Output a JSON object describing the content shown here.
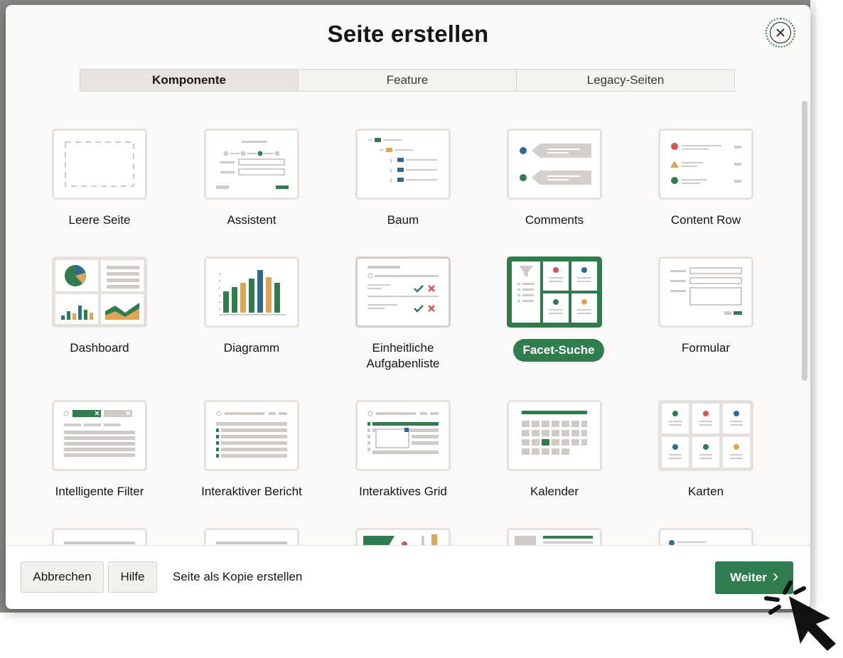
{
  "dialog": {
    "title": "Seite erstellen",
    "close_icon": "close-circle-icon"
  },
  "tabs": [
    {
      "label": "Komponente",
      "active": true
    },
    {
      "label": "Feature",
      "active": false
    },
    {
      "label": "Legacy-Seiten",
      "active": false
    }
  ],
  "tiles": [
    {
      "label": "Leere Seite",
      "icon": "blank-page-icon"
    },
    {
      "label": "Assistent",
      "icon": "wizard-icon"
    },
    {
      "label": "Baum",
      "icon": "tree-icon"
    },
    {
      "label": "Comments",
      "icon": "comments-icon"
    },
    {
      "label": "Content Row",
      "icon": "content-row-icon"
    },
    {
      "label": "Dashboard",
      "icon": "dashboard-icon"
    },
    {
      "label": "Diagramm",
      "icon": "chart-icon"
    },
    {
      "label": "Einheitliche Aufgabenliste",
      "icon": "task-list-icon"
    },
    {
      "label": "Facet-Suche",
      "icon": "faceted-search-icon",
      "selected": true
    },
    {
      "label": "Formular",
      "icon": "form-icon"
    },
    {
      "label": "Intelligente Filter",
      "icon": "smart-filters-icon"
    },
    {
      "label": "Interaktiver Bericht",
      "icon": "interactive-report-icon"
    },
    {
      "label": "Interaktives Grid",
      "icon": "interactive-grid-icon"
    },
    {
      "label": "Kalender",
      "icon": "calendar-icon"
    },
    {
      "label": "Karten",
      "icon": "cards-icon"
    },
    {
      "label": "",
      "icon": "list-view-icon"
    },
    {
      "label": "",
      "icon": "master-detail-icon"
    },
    {
      "label": "",
      "icon": "map-icon"
    },
    {
      "label": "",
      "icon": "report-with-form-icon"
    },
    {
      "label": "",
      "icon": "timeline-icon"
    }
  ],
  "footer": {
    "cancel_label": "Abbrechen",
    "help_label": "Hilfe",
    "copy_label": "Seite als Kopie erstellen",
    "next_label": "Weiter",
    "next_icon": "chevron-right-icon"
  },
  "colors": {
    "accent": "#2f7d4f",
    "orange": "#e0a455",
    "blue": "#2f6a8f",
    "red": "#d9534f"
  }
}
